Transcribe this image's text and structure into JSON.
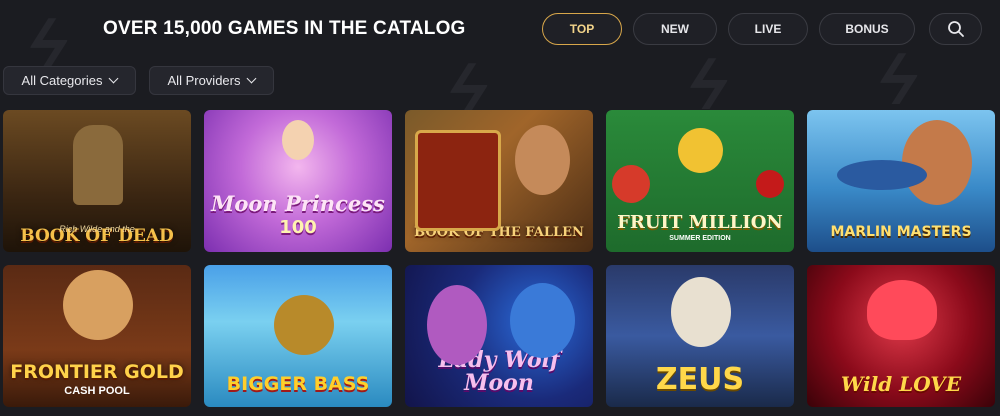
{
  "header": {
    "title": "OVER 15,000 GAMES IN THE CATALOG"
  },
  "tabs": [
    {
      "label": "TOP",
      "active": true
    },
    {
      "label": "NEW",
      "active": false
    },
    {
      "label": "LIVE",
      "active": false
    },
    {
      "label": "BONUS",
      "active": false
    }
  ],
  "search": {
    "icon": "search-icon"
  },
  "filters": {
    "categories": "All Categories",
    "providers": "All Providers"
  },
  "games": [
    {
      "title": "BOOK OF DEAD",
      "subtitle": "Rich Wilde and the"
    },
    {
      "title": "Moon Princess",
      "subtitle": "100"
    },
    {
      "title": "BOOK OF THE FALLEN",
      "subtitle": ""
    },
    {
      "title": "FRUIT MILLION",
      "subtitle": "SUMMER EDITION"
    },
    {
      "title": "MARLIN MASTERS",
      "subtitle": ""
    },
    {
      "title": "FRONTIER GOLD",
      "subtitle": "CASH POOL"
    },
    {
      "title": "BIGGER BASS",
      "subtitle": ""
    },
    {
      "title": "Lady Wolf Moon",
      "subtitle": ""
    },
    {
      "title": "ZEUS",
      "subtitle": ""
    },
    {
      "title": "Wild LOVE",
      "subtitle": ""
    }
  ],
  "colors": {
    "accent": "#d7a64a",
    "background": "#1b1c21"
  }
}
